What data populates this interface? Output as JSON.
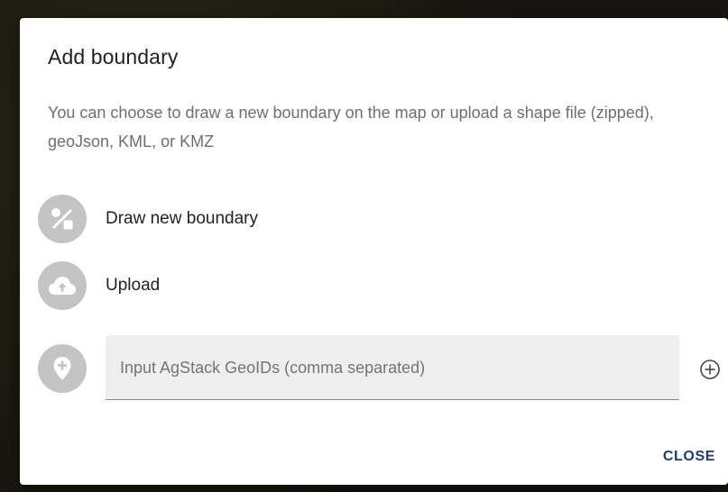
{
  "dialog": {
    "title": "Add boundary",
    "description": "You can choose to draw a new boundary on the map or upload a shape file (zipped), geoJson, KML, or KMZ"
  },
  "options": [
    {
      "label": "Draw new boundary",
      "icon": "draw-shapes-icon"
    },
    {
      "label": "Upload",
      "icon": "cloud-upload-icon"
    }
  ],
  "geoid": {
    "placeholder": "Input AgStack GeoIDs (comma separated)",
    "value": "",
    "icon": "location-pin-icon",
    "add_icon": "add-circle-icon"
  },
  "actions": {
    "close_label": "CLOSE"
  },
  "colors": {
    "accent": "#1e3a78",
    "icon_circle": "#c4c4c4",
    "field_background": "#eeeeee"
  }
}
